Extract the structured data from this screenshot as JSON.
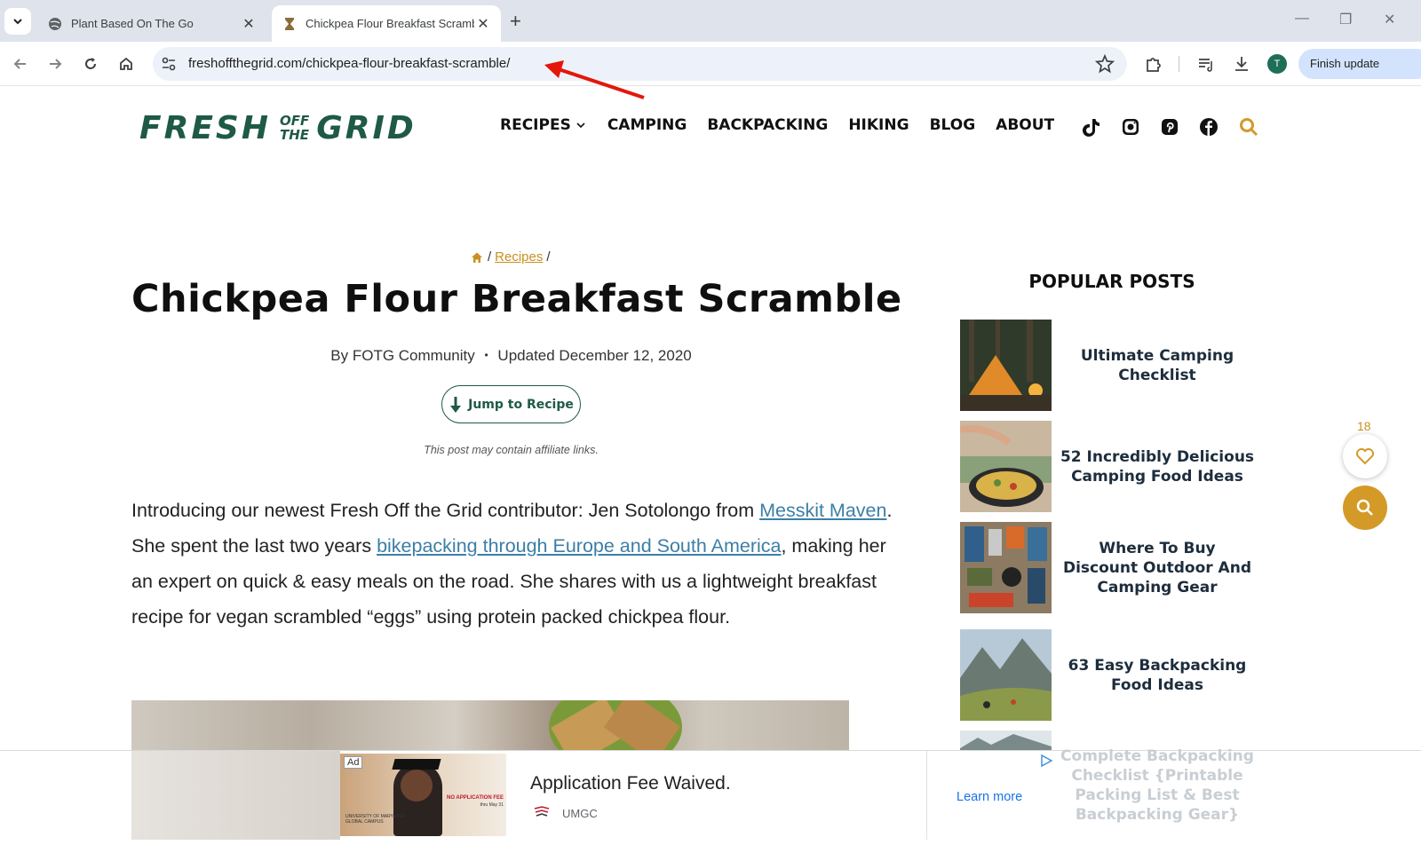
{
  "browser": {
    "tabs": [
      {
        "title": "Plant Based On The Go",
        "active": false
      },
      {
        "title": "Chickpea Flour Breakfast Scrambl",
        "active": true
      }
    ],
    "new_tab_label": "+",
    "url": "freshoffthegrid.com/chickpea-flour-breakfast-scramble/",
    "profile_initial": "T",
    "finish_update_label": "Finish update",
    "accent_color": "#d3e3fd"
  },
  "site": {
    "logo": {
      "word1": "FRESH",
      "small_top": "OFF",
      "small_bottom": "THE",
      "word2": "GRID",
      "color": "#1e5a45"
    },
    "nav": [
      {
        "label": "RECIPES",
        "has_dropdown": true
      },
      {
        "label": "CAMPING"
      },
      {
        "label": "BACKPACKING"
      },
      {
        "label": "HIKING"
      },
      {
        "label": "BLOG"
      },
      {
        "label": "ABOUT"
      }
    ],
    "social_icons": [
      "tiktok-icon",
      "instagram-icon",
      "pinterest-icon",
      "facebook-icon"
    ],
    "accent_color": "#d39a28"
  },
  "article": {
    "breadcrumb": {
      "link": "Recipes",
      "sep": "/"
    },
    "title": "Chickpea Flour Breakfast Scramble",
    "byline": {
      "prefix": "By",
      "author": "FOTG Community",
      "dot": "•",
      "updated": "Updated December 12, 2020"
    },
    "jump_label": "Jump to Recipe",
    "affiliate_note": "This post may contain affiliate links.",
    "intro": {
      "p1": "Introducing our newest Fresh Off the Grid contributor: Jen Sotolongo from ",
      "link1": "Messkit Maven",
      "p2": ". She spent the last two years ",
      "link2": "bikepacking through Europe and South America",
      "p3": ", making her an expert on quick & easy meals on the road. She shares with us a lightweight breakfast recipe for vegan scrambled “eggs” using protein packed chickpea flour."
    }
  },
  "sidebar": {
    "title": "POPULAR POSTS",
    "posts": [
      {
        "title": "Ultimate Camping Checklist"
      },
      {
        "title": "52 Incredibly Delicious Camping Food Ideas"
      },
      {
        "title": "Where To Buy Discount Outdoor And Camping Gear"
      },
      {
        "title": "63 Easy Backpacking Food Ideas"
      },
      {
        "title": "Complete Backpacking Checklist {Printable Packing List & Best Backpacking Gear}"
      }
    ]
  },
  "floating": {
    "like_count": "18"
  },
  "ad": {
    "tag": "Ad",
    "image_text": {
      "no_fee": "NO APPLICATION FEE",
      "thru": "thru May 31",
      "school": "UNIVERSITY OF MARYLAND GLOBAL CAMPUS"
    },
    "headline": "Application Fee Waived.",
    "brand": "UMGC",
    "cta": "Learn more"
  }
}
